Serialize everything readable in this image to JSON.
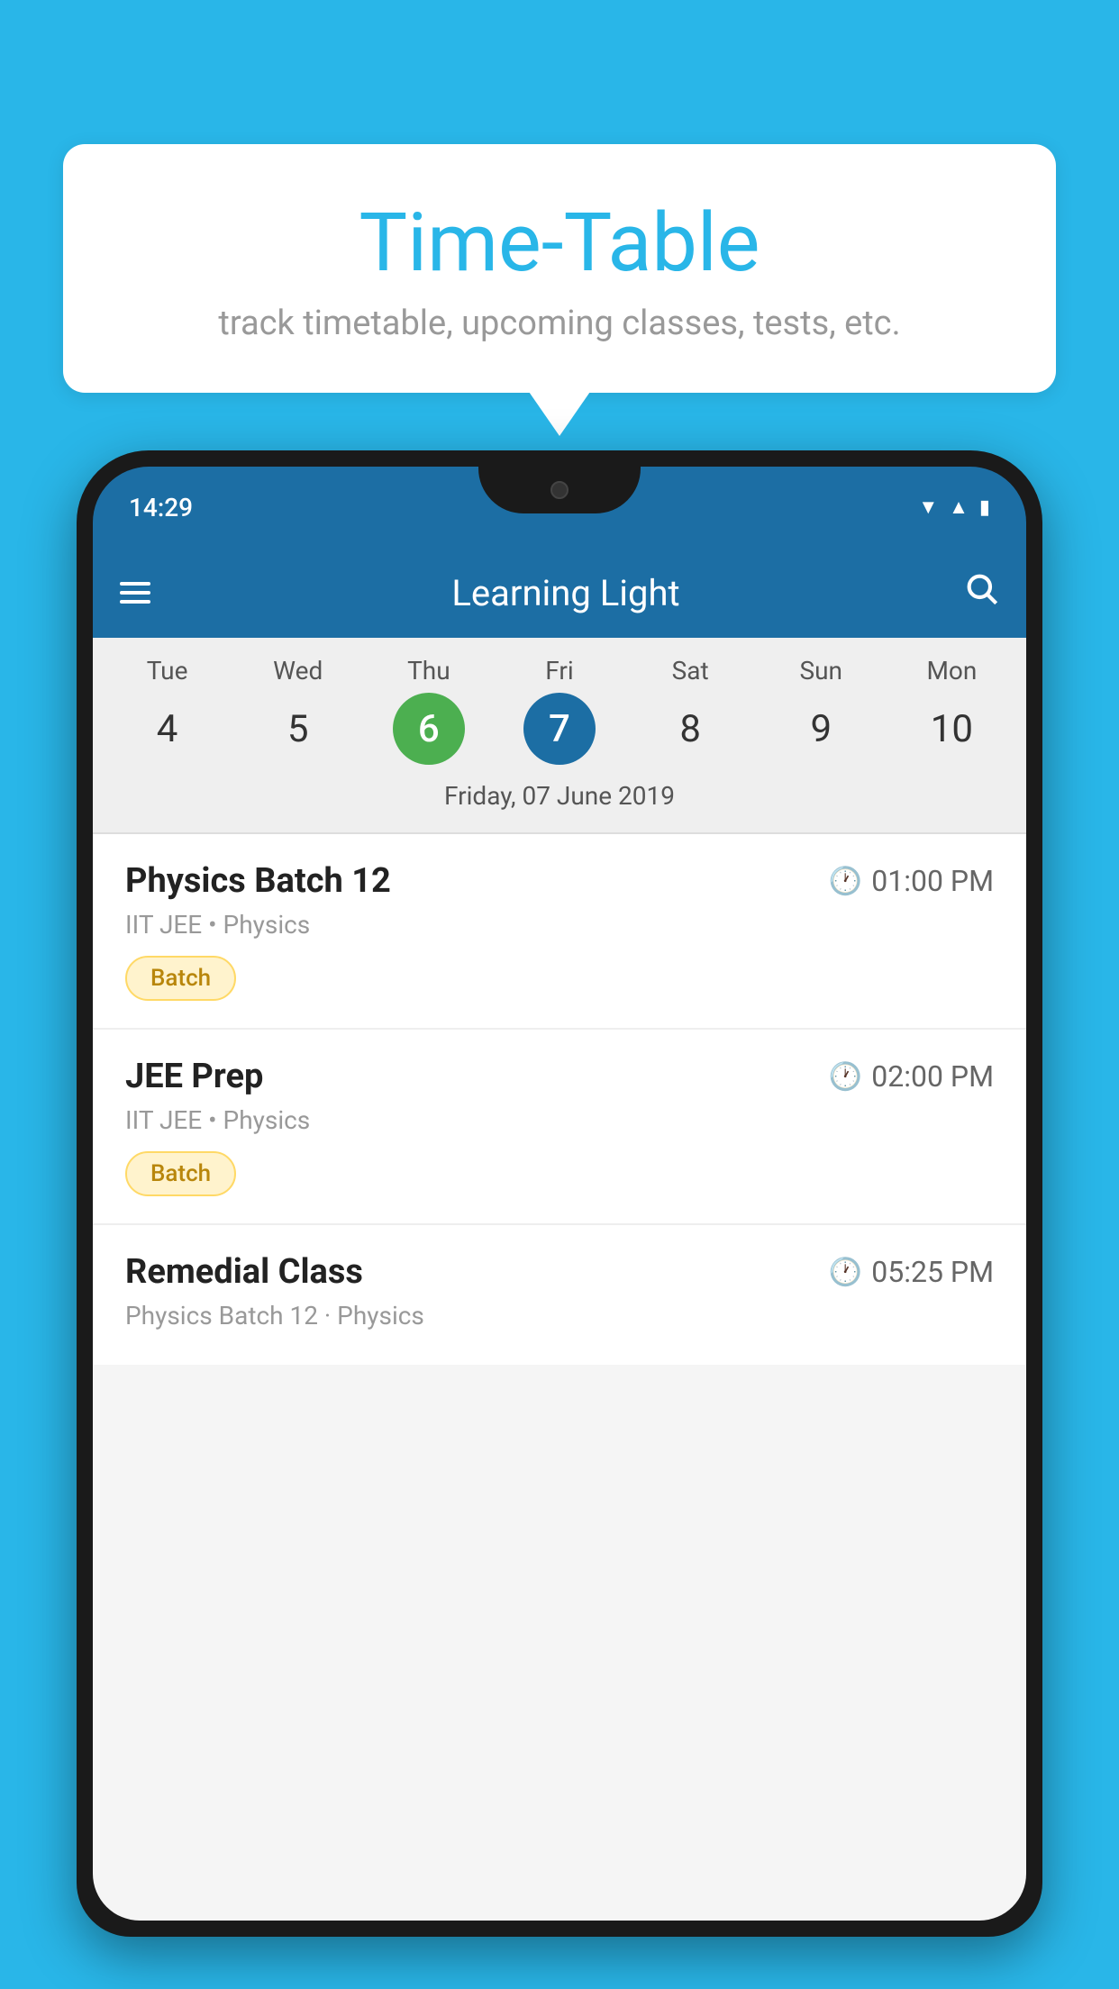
{
  "background": {
    "color": "#29b6e8"
  },
  "speech_bubble": {
    "title": "Time-Table",
    "subtitle": "track timetable, upcoming classes, tests, etc."
  },
  "phone": {
    "status_bar": {
      "time": "14:29",
      "icons": [
        "wifi",
        "signal",
        "battery"
      ]
    },
    "app_bar": {
      "title": "Learning Light",
      "menu_icon": "menu",
      "search_icon": "search"
    },
    "calendar": {
      "days": [
        {
          "label": "Tue",
          "num": "4"
        },
        {
          "label": "Wed",
          "num": "5"
        },
        {
          "label": "Thu",
          "num": "6",
          "state": "today"
        },
        {
          "label": "Fri",
          "num": "7",
          "state": "selected"
        },
        {
          "label": "Sat",
          "num": "8"
        },
        {
          "label": "Sun",
          "num": "9"
        },
        {
          "label": "Mon",
          "num": "10"
        }
      ],
      "selected_date_label": "Friday, 07 June 2019"
    },
    "classes": [
      {
        "name": "Physics Batch 12",
        "time": "01:00 PM",
        "meta": "IIT JEE • Physics",
        "tag": "Batch"
      },
      {
        "name": "JEE Prep",
        "time": "02:00 PM",
        "meta": "IIT JEE • Physics",
        "tag": "Batch"
      },
      {
        "name": "Remedial Class",
        "time": "05:25 PM",
        "meta": "Physics Batch 12 · Physics",
        "tag": null
      }
    ]
  }
}
